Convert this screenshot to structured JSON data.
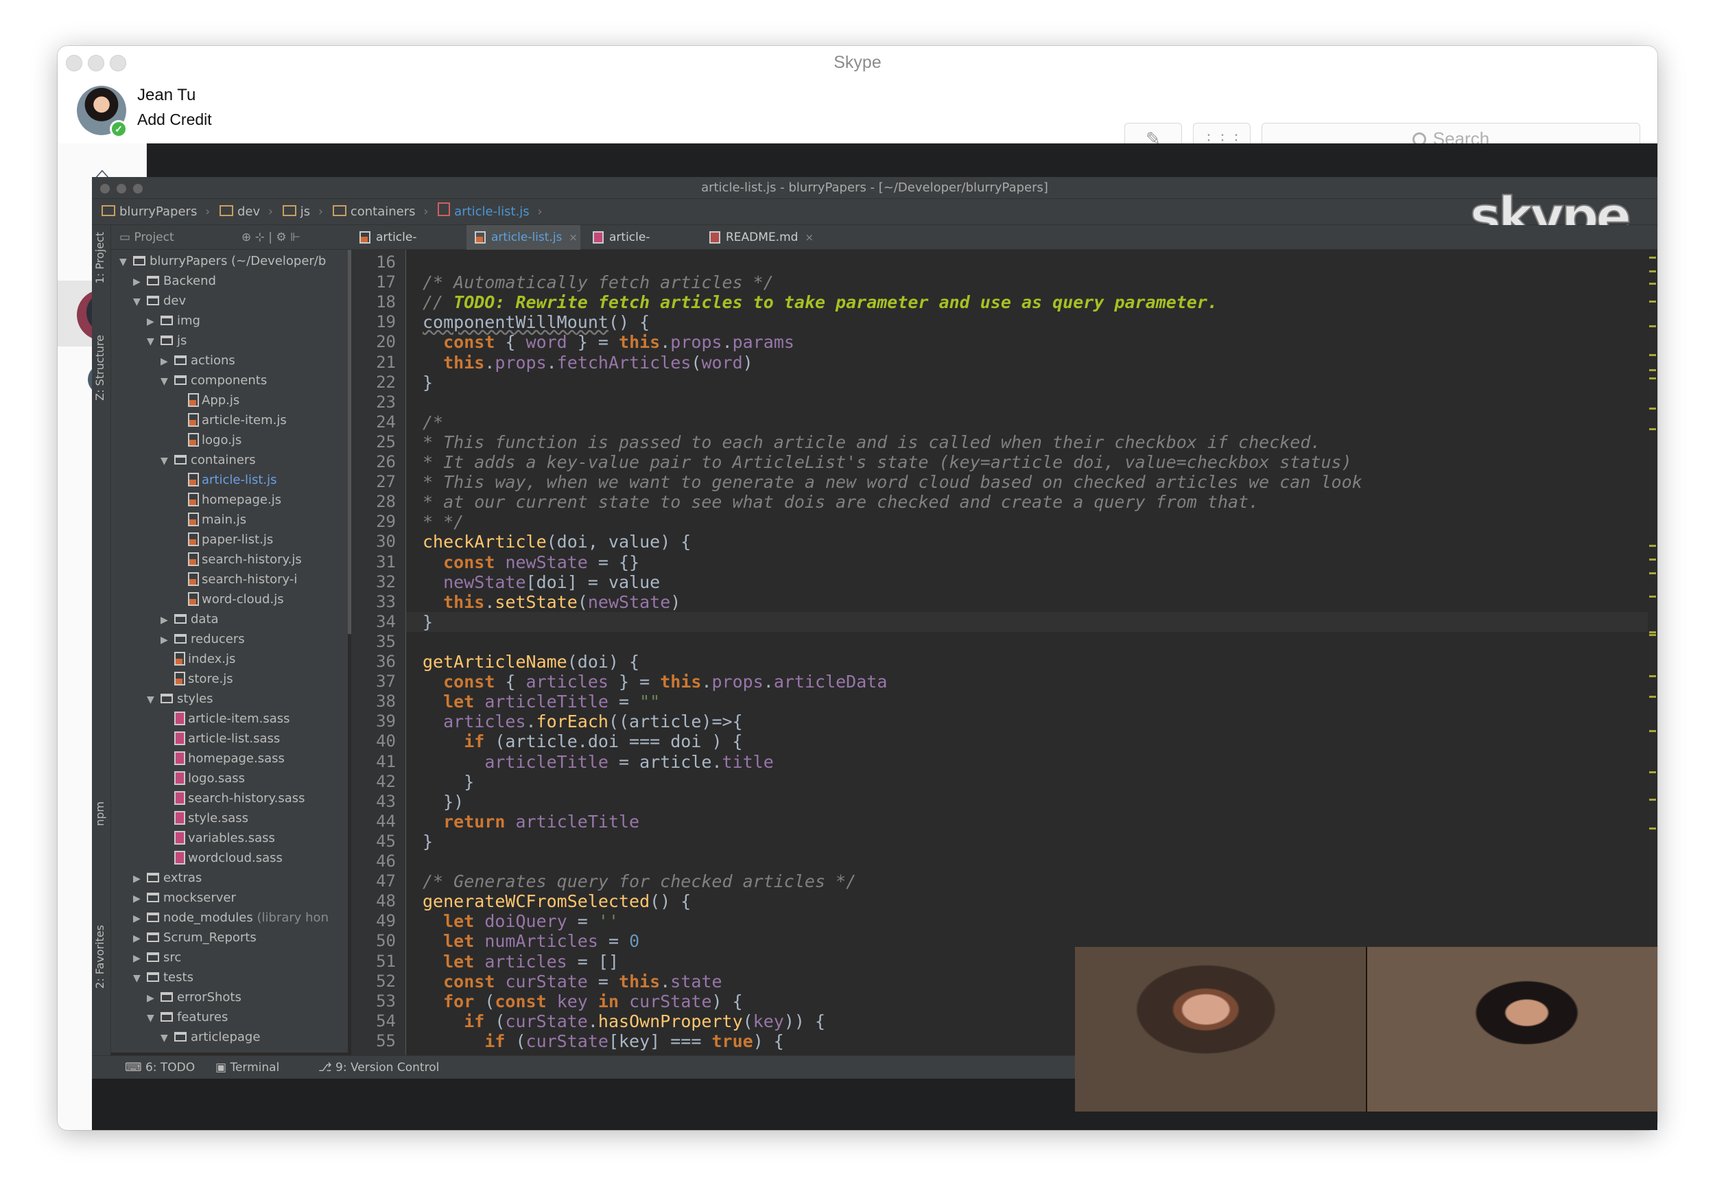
{
  "window": {
    "title": "Skype"
  },
  "user": {
    "name": "Jean Tu",
    "credit": "Add Credit",
    "status": "online"
  },
  "toolbar": {
    "search_placeholder": "Search",
    "compose_icon": "compose-icon",
    "dialpad_icon": "dialpad-icon"
  },
  "nav": {
    "items": [
      "home",
      "contacts",
      "calls",
      "active-call",
      "recent"
    ]
  },
  "ide": {
    "title": "article-list.js - blurryPapers - [~/Developer/blurryPapers]",
    "breadcrumbs": [
      "blurryPapers",
      "dev",
      "js",
      "containers",
      "article-list.js"
    ],
    "project_label": "Project",
    "side_tabs": [
      "1: Project",
      "Z: Structure",
      "npm",
      "2: Favorites"
    ],
    "tabs": [
      {
        "label": "article-item.js",
        "icon": "js"
      },
      {
        "label": "article-list.js",
        "icon": "js"
      },
      {
        "label": "article-item.sass",
        "icon": "sass"
      },
      {
        "label": "README.md",
        "icon": "md"
      }
    ],
    "tree": [
      {
        "label": "blurryPapers (~/Developer/b",
        "kind": "folder",
        "depth": 0,
        "open": true
      },
      {
        "label": "Backend",
        "kind": "folder",
        "depth": 1,
        "open": false
      },
      {
        "label": "dev",
        "kind": "folder",
        "depth": 1,
        "open": true
      },
      {
        "label": "img",
        "kind": "folder",
        "depth": 2,
        "open": false
      },
      {
        "label": "js",
        "kind": "folder",
        "depth": 2,
        "open": true
      },
      {
        "label": "actions",
        "kind": "folder",
        "depth": 3,
        "open": false
      },
      {
        "label": "components",
        "kind": "folder",
        "depth": 3,
        "open": true
      },
      {
        "label": "App.js",
        "kind": "js",
        "depth": 4
      },
      {
        "label": "article-item.js",
        "kind": "js",
        "depth": 4
      },
      {
        "label": "logo.js",
        "kind": "js",
        "depth": 4
      },
      {
        "label": "containers",
        "kind": "folder",
        "depth": 3,
        "open": true
      },
      {
        "label": "article-list.js",
        "kind": "js",
        "depth": 4,
        "selected": true
      },
      {
        "label": "homepage.js",
        "kind": "js",
        "depth": 4
      },
      {
        "label": "main.js",
        "kind": "js",
        "depth": 4
      },
      {
        "label": "paper-list.js",
        "kind": "js",
        "depth": 4
      },
      {
        "label": "search-history.js",
        "kind": "js",
        "depth": 4
      },
      {
        "label": "search-history-i",
        "kind": "js",
        "depth": 4
      },
      {
        "label": "word-cloud.js",
        "kind": "js",
        "depth": 4
      },
      {
        "label": "data",
        "kind": "folder",
        "depth": 3,
        "open": false
      },
      {
        "label": "reducers",
        "kind": "folder",
        "depth": 3,
        "open": false
      },
      {
        "label": "index.js",
        "kind": "js",
        "depth": 3
      },
      {
        "label": "store.js",
        "kind": "js",
        "depth": 3
      },
      {
        "label": "styles",
        "kind": "folder",
        "depth": 2,
        "open": true
      },
      {
        "label": "article-item.sass",
        "kind": "sass",
        "depth": 3
      },
      {
        "label": "article-list.sass",
        "kind": "sass",
        "depth": 3
      },
      {
        "label": "homepage.sass",
        "kind": "sass",
        "depth": 3
      },
      {
        "label": "logo.sass",
        "kind": "sass",
        "depth": 3
      },
      {
        "label": "search-history.sass",
        "kind": "sass",
        "depth": 3
      },
      {
        "label": "style.sass",
        "kind": "sass",
        "depth": 3
      },
      {
        "label": "variables.sass",
        "kind": "sass",
        "depth": 3
      },
      {
        "label": "wordcloud.sass",
        "kind": "sass",
        "depth": 3
      },
      {
        "label": "extras",
        "kind": "folder",
        "depth": 1,
        "open": false
      },
      {
        "label": "mockserver",
        "kind": "folder",
        "depth": 1,
        "open": false
      },
      {
        "label": "node_modules",
        "kind": "folder",
        "depth": 1,
        "open": false,
        "tag": "(library hon"
      },
      {
        "label": "Scrum_Reports",
        "kind": "folder",
        "depth": 1,
        "open": false
      },
      {
        "label": "src",
        "kind": "folder",
        "depth": 1,
        "open": false
      },
      {
        "label": "tests",
        "kind": "folder",
        "depth": 1,
        "open": true
      },
      {
        "label": "errorShots",
        "kind": "folder",
        "depth": 2,
        "open": false
      },
      {
        "label": "features",
        "kind": "folder",
        "depth": 2,
        "open": true
      },
      {
        "label": "articlepage",
        "kind": "folder",
        "depth": 3,
        "open": true
      }
    ],
    "code": [
      {
        "n": "16",
        "t": [
          [
            "",
            ""
          ]
        ]
      },
      {
        "n": "17",
        "t": [
          [
            "cm",
            "/* Automatically fetch articles */"
          ]
        ]
      },
      {
        "n": "18",
        "t": [
          [
            "cm",
            "// "
          ],
          [
            "todo",
            "TODO: Rewrite fetch articles to take parameter and use as query parameter."
          ]
        ]
      },
      {
        "n": "19",
        "t": [
          [
            "ul",
            "componentWillMount"
          ],
          [
            "",
            "() {"
          ]
        ]
      },
      {
        "n": "20",
        "t": [
          [
            "",
            "  "
          ],
          [
            "kw",
            "const"
          ],
          [
            "",
            " { "
          ],
          [
            "pr",
            "word"
          ],
          [
            "",
            " } = "
          ],
          [
            "kw",
            "this"
          ],
          [
            "",
            "."
          ],
          [
            "pr",
            "props"
          ],
          [
            "",
            "."
          ],
          [
            "pr",
            "params"
          ]
        ]
      },
      {
        "n": "21",
        "t": [
          [
            "",
            "  "
          ],
          [
            "kw",
            "this"
          ],
          [
            "",
            "."
          ],
          [
            "pr",
            "props"
          ],
          [
            "",
            "."
          ],
          [
            "pr",
            "fetchArticles"
          ],
          [
            "",
            "("
          ],
          [
            "pr",
            "word"
          ],
          [
            "",
            ")"
          ]
        ]
      },
      {
        "n": "22",
        "t": [
          [
            "",
            "}"
          ]
        ]
      },
      {
        "n": "23",
        "t": [
          [
            "",
            ""
          ]
        ]
      },
      {
        "n": "24",
        "t": [
          [
            "cm",
            "/*"
          ]
        ]
      },
      {
        "n": "25",
        "t": [
          [
            "cm",
            "* This function is passed to each article and is called when their checkbox if checked."
          ]
        ]
      },
      {
        "n": "26",
        "t": [
          [
            "cm",
            "* It adds a key-value pair to ArticleList's state (key=article doi, value=checkbox status)"
          ]
        ]
      },
      {
        "n": "27",
        "t": [
          [
            "cm",
            "* This way, when we want to generate a new word cloud based on checked articles we can look"
          ]
        ]
      },
      {
        "n": "28",
        "t": [
          [
            "cm",
            "* at our current state to see what dois are checked and create a query from that."
          ]
        ]
      },
      {
        "n": "29",
        "t": [
          [
            "cm",
            "* */"
          ]
        ]
      },
      {
        "n": "30",
        "t": [
          [
            "fn",
            "checkArticle"
          ],
          [
            "",
            "(doi, value) {"
          ]
        ]
      },
      {
        "n": "31",
        "t": [
          [
            "",
            "  "
          ],
          [
            "kw",
            "const"
          ],
          [
            "",
            " "
          ],
          [
            "pr",
            "newState"
          ],
          [
            "",
            " = {}"
          ]
        ]
      },
      {
        "n": "32",
        "t": [
          [
            "",
            "  "
          ],
          [
            "pr",
            "newState"
          ],
          [
            "",
            "[doi] = value"
          ]
        ]
      },
      {
        "n": "33",
        "t": [
          [
            "",
            "  "
          ],
          [
            "kw",
            "this"
          ],
          [
            "",
            "."
          ],
          [
            "fn",
            "setState"
          ],
          [
            "",
            "("
          ],
          [
            "pr",
            "newState"
          ],
          [
            "",
            ")"
          ]
        ]
      },
      {
        "n": "34",
        "t": [
          [
            "",
            "}"
          ]
        ],
        "cur": true
      },
      {
        "n": "35",
        "t": [
          [
            "",
            ""
          ]
        ]
      },
      {
        "n": "36",
        "t": [
          [
            "fn",
            "getArticleName"
          ],
          [
            "",
            "(doi) {"
          ]
        ]
      },
      {
        "n": "37",
        "t": [
          [
            "",
            "  "
          ],
          [
            "kw",
            "const"
          ],
          [
            "",
            " { "
          ],
          [
            "pr",
            "articles"
          ],
          [
            "",
            " } = "
          ],
          [
            "kw",
            "this"
          ],
          [
            "",
            "."
          ],
          [
            "pr",
            "props"
          ],
          [
            "",
            "."
          ],
          [
            "pr",
            "articleData"
          ]
        ]
      },
      {
        "n": "38",
        "t": [
          [
            "",
            "  "
          ],
          [
            "kw",
            "let"
          ],
          [
            "",
            " "
          ],
          [
            "pr",
            "articleTitle"
          ],
          [
            "",
            " = "
          ],
          [
            "st",
            "\"\""
          ]
        ]
      },
      {
        "n": "39",
        "t": [
          [
            "",
            "  "
          ],
          [
            "pr",
            "articles"
          ],
          [
            "",
            "."
          ],
          [
            "fn",
            "forEach"
          ],
          [
            "",
            "((article)=>{"
          ]
        ]
      },
      {
        "n": "40",
        "t": [
          [
            "",
            "    "
          ],
          [
            "kw",
            "if"
          ],
          [
            "",
            " (article.doi === doi ) {"
          ]
        ]
      },
      {
        "n": "41",
        "t": [
          [
            "",
            "      "
          ],
          [
            "pr",
            "articleTitle"
          ],
          [
            "",
            " = article."
          ],
          [
            "pr",
            "title"
          ]
        ]
      },
      {
        "n": "42",
        "t": [
          [
            "",
            "    }"
          ]
        ]
      },
      {
        "n": "43",
        "t": [
          [
            "",
            "  })"
          ]
        ]
      },
      {
        "n": "44",
        "t": [
          [
            "",
            "  "
          ],
          [
            "kw",
            "return"
          ],
          [
            "",
            " "
          ],
          [
            "pr",
            "articleTitle"
          ]
        ]
      },
      {
        "n": "45",
        "t": [
          [
            "",
            "}"
          ]
        ]
      },
      {
        "n": "46",
        "t": [
          [
            "",
            ""
          ]
        ]
      },
      {
        "n": "47",
        "t": [
          [
            "cm",
            "/* Generates query for checked articles */"
          ]
        ]
      },
      {
        "n": "48",
        "t": [
          [
            "fn",
            "generateWCFromSelected"
          ],
          [
            "",
            "() {"
          ]
        ]
      },
      {
        "n": "49",
        "t": [
          [
            "",
            "  "
          ],
          [
            "kw",
            "let"
          ],
          [
            "",
            " "
          ],
          [
            "pr",
            "doiQuery"
          ],
          [
            "",
            " = "
          ],
          [
            "st",
            "''"
          ]
        ]
      },
      {
        "n": "50",
        "t": [
          [
            "",
            "  "
          ],
          [
            "kw",
            "let"
          ],
          [
            "",
            " "
          ],
          [
            "pr",
            "numArticles"
          ],
          [
            "",
            " = "
          ],
          [
            "nm",
            "0"
          ]
        ]
      },
      {
        "n": "51",
        "t": [
          [
            "",
            "  "
          ],
          [
            "kw",
            "let"
          ],
          [
            "",
            " "
          ],
          [
            "pr",
            "articles"
          ],
          [
            "",
            " = []"
          ]
        ]
      },
      {
        "n": "52",
        "t": [
          [
            "",
            "  "
          ],
          [
            "kw",
            "const"
          ],
          [
            "",
            " "
          ],
          [
            "pr",
            "curState"
          ],
          [
            "",
            " = "
          ],
          [
            "kw",
            "this"
          ],
          [
            "",
            "."
          ],
          [
            "pr",
            "state"
          ]
        ]
      },
      {
        "n": "53",
        "t": [
          [
            "",
            "  "
          ],
          [
            "kw",
            "for"
          ],
          [
            "",
            " ("
          ],
          [
            "kw",
            "const"
          ],
          [
            "",
            " "
          ],
          [
            "pr",
            "key"
          ],
          [
            "",
            " "
          ],
          [
            "kw",
            "in"
          ],
          [
            "",
            " "
          ],
          [
            "pr",
            "curState"
          ],
          [
            "",
            ") {"
          ]
        ]
      },
      {
        "n": "54",
        "t": [
          [
            "",
            "    "
          ],
          [
            "kw",
            "if"
          ],
          [
            "",
            " ("
          ],
          [
            "pr",
            "curState"
          ],
          [
            "",
            "."
          ],
          [
            "fn",
            "hasOwnProperty"
          ],
          [
            "",
            "("
          ],
          [
            "pr",
            "key"
          ],
          [
            "",
            ")) {"
          ]
        ]
      },
      {
        "n": "55",
        "t": [
          [
            "",
            "      "
          ],
          [
            "kw",
            "if"
          ],
          [
            "",
            " ("
          ],
          [
            "pr",
            "curState"
          ],
          [
            "",
            "[key] === "
          ],
          [
            "kw",
            "true"
          ],
          [
            "",
            ") {"
          ]
        ]
      }
    ],
    "bottom_tabs": [
      "6: TODO",
      "Terminal",
      "9: Version Control"
    ],
    "logo_text": "skype"
  },
  "colors": {
    "accent": "#4b96d6",
    "online": "#47b64a",
    "editor_bg": "#2b2b2b"
  }
}
